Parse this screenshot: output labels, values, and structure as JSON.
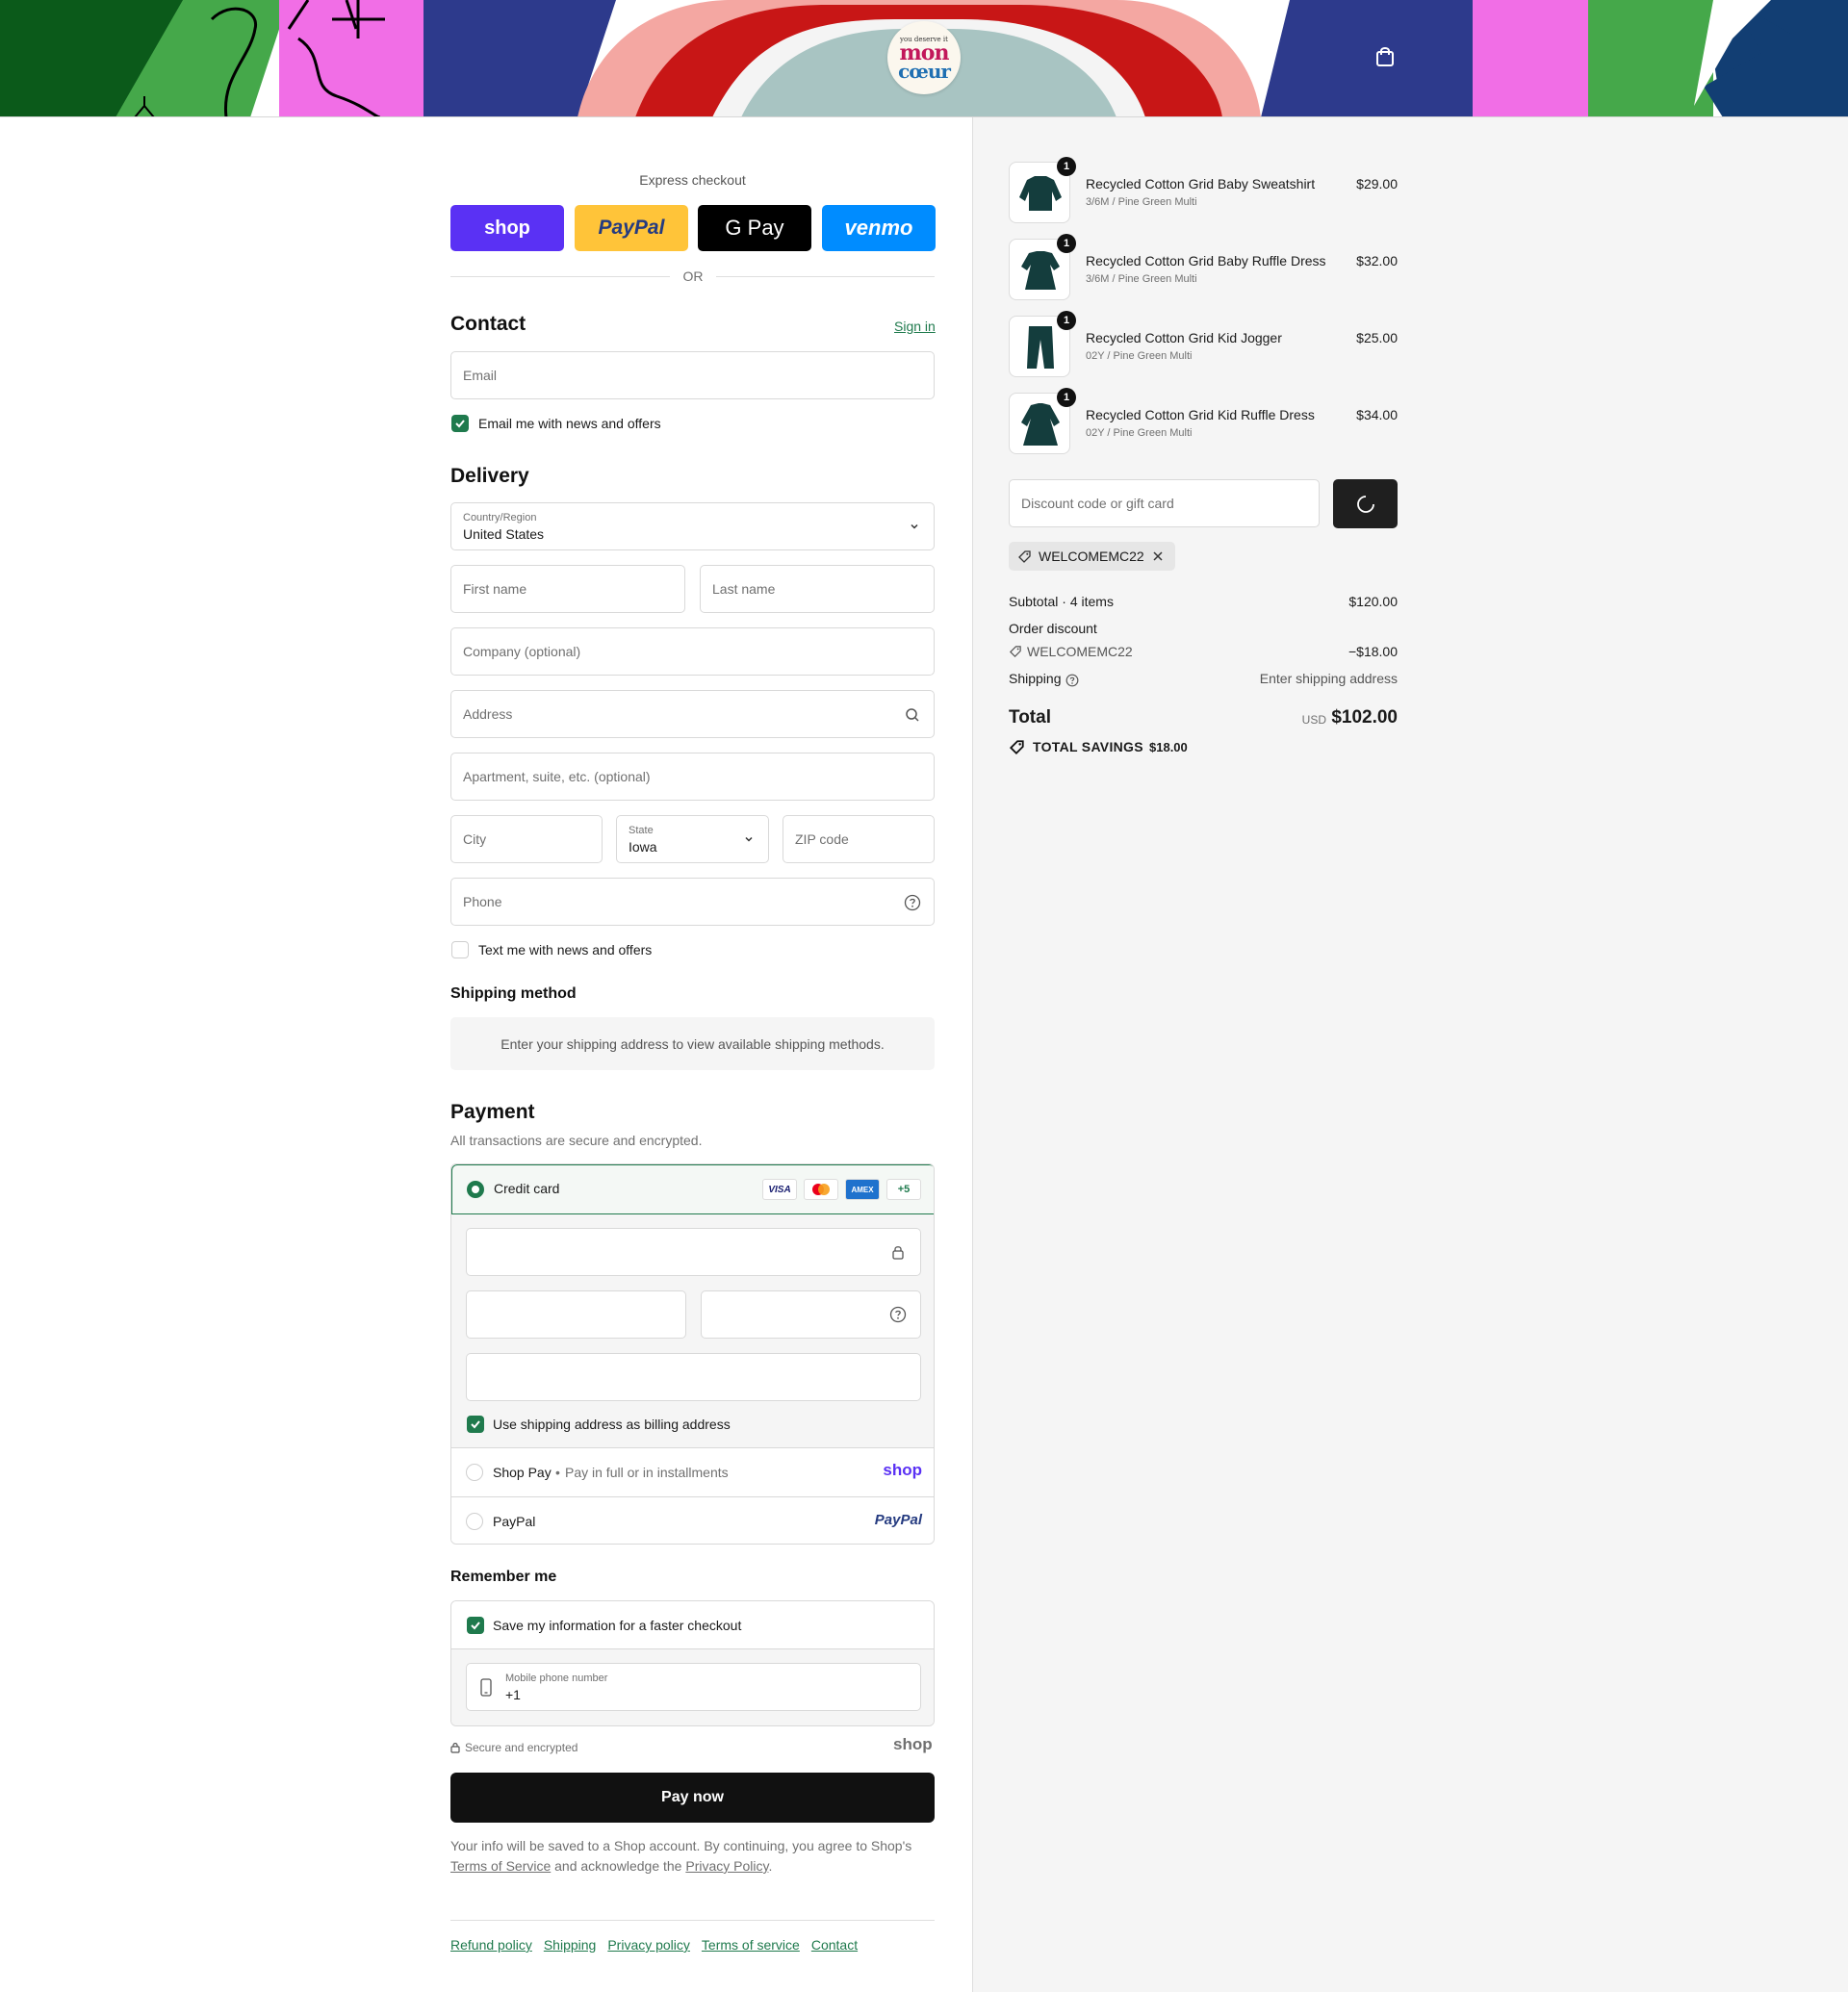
{
  "header": {
    "logo_tagline": "you deserve it",
    "logo_line1": "mon",
    "logo_line2": "cœur"
  },
  "colors": {
    "accent": "#1f7a4d",
    "shop_purple": "#5a31f4",
    "paypal_yellow": "#ffc439",
    "venmo_blue": "#008cff",
    "button_dark": "#111111"
  },
  "express": {
    "title": "Express checkout",
    "buttons": [
      "shop",
      "PayPal",
      "G Pay",
      "venmo"
    ],
    "or_label": "OR"
  },
  "contact": {
    "heading": "Contact",
    "sign_in": "Sign in",
    "email_placeholder": "Email",
    "email_offers_label": "Email me with news and offers"
  },
  "delivery": {
    "heading": "Delivery",
    "country_label": "Country/Region",
    "country_value": "United States",
    "first_name": "First name",
    "last_name": "Last name",
    "company": "Company (optional)",
    "address": "Address",
    "apartment": "Apartment, suite, etc. (optional)",
    "city": "City",
    "state_label": "State",
    "state_value": "Iowa",
    "zip": "ZIP code",
    "phone": "Phone",
    "text_offers_label": "Text me with news and offers"
  },
  "shipping_method": {
    "heading": "Shipping method",
    "message": "Enter your shipping address to view available shipping methods."
  },
  "payment": {
    "heading": "Payment",
    "subtitle": "All transactions are secure and encrypted.",
    "credit_card_label": "Credit card",
    "card_logos": [
      "VISA",
      "MC",
      "AMEX",
      "+5"
    ],
    "billing_label": "Use shipping address as billing address",
    "shop_pay_label": "Shop Pay",
    "shop_pay_sub": "Pay in full or in installments",
    "shop_pay_logo": "shop",
    "paypal_label": "PayPal",
    "paypal_logo": "PayPal"
  },
  "remember": {
    "heading": "Remember me",
    "save_label": "Save my information for a faster checkout",
    "phone_label": "Mobile phone number",
    "phone_value": "+1",
    "secure_label": "Secure and encrypted",
    "shop_logo": "shop"
  },
  "pay_button": "Pay now",
  "legal": {
    "text1": "Your info will be saved to a Shop account. By continuing, you agree to Shop's",
    "tos": "Terms of Service",
    "text2": "and acknowledge the",
    "privacy": "Privacy Policy",
    "text3": "."
  },
  "footer_links": [
    "Refund policy",
    "Shipping",
    "Privacy policy",
    "Terms of service",
    "Contact"
  ],
  "order": {
    "items": [
      {
        "name": "Recycled Cotton Grid Baby Sweatshirt",
        "variant": "3/6M / Pine Green Multi",
        "price": "$29.00",
        "qty": "1"
      },
      {
        "name": "Recycled Cotton Grid Baby Ruffle Dress",
        "variant": "3/6M / Pine Green Multi",
        "price": "$32.00",
        "qty": "1"
      },
      {
        "name": "Recycled Cotton Grid Kid Jogger",
        "variant": "02Y / Pine Green Multi",
        "price": "$25.00",
        "qty": "1"
      },
      {
        "name": "Recycled Cotton Grid Kid Ruffle Dress",
        "variant": "02Y / Pine Green Multi",
        "price": "$34.00",
        "qty": "1"
      }
    ],
    "discount_placeholder": "Discount code or gift card",
    "applied_code": "WELCOMEMC22",
    "subtotal_label": "Subtotal · 4 items",
    "subtotal_value": "$120.00",
    "order_discount_label": "Order discount",
    "discount_code": "WELCOMEMC22",
    "discount_value": "−$18.00",
    "shipping_label": "Shipping",
    "shipping_value": "Enter shipping address",
    "total_label": "Total",
    "currency": "USD",
    "total_value": "$102.00",
    "savings_label": "TOTAL SAVINGS",
    "savings_value": "$18.00"
  }
}
